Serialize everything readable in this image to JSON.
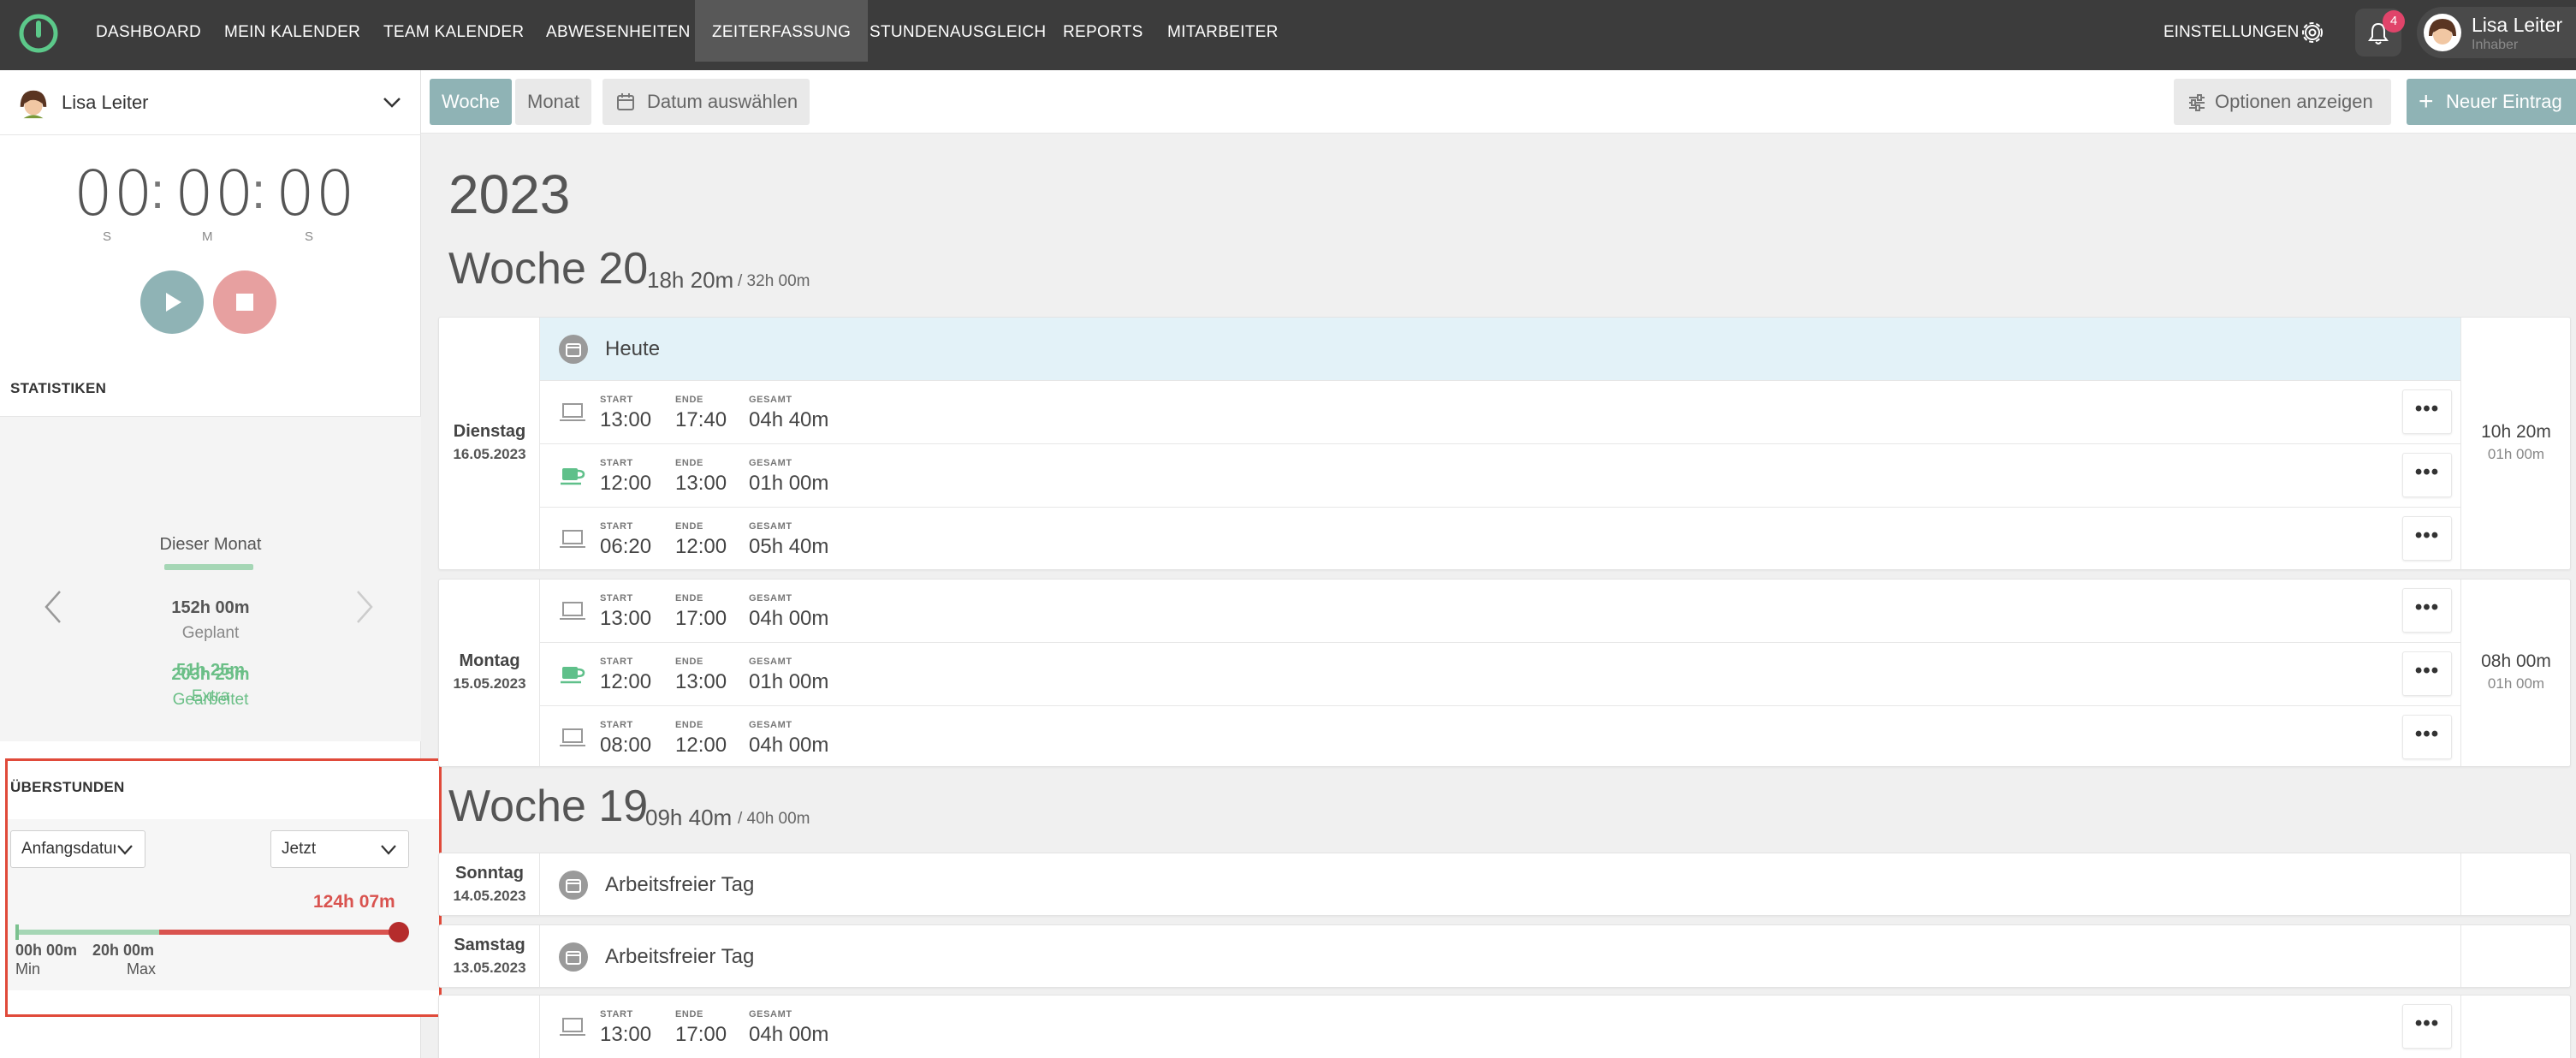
{
  "nav": {
    "items": [
      "DASHBOARD",
      "MEIN KALENDER",
      "TEAM KALENDER",
      "ABWESENHEITEN",
      "ZEITERFASSUNG",
      "STUNDENAUSGLEICH",
      "REPORTS",
      "MITARBEITER"
    ],
    "active": "ZEITERFASSUNG",
    "settings_label": "EINSTELLUNGEN",
    "notification_count": "4",
    "user_name": "Lisa Leiter",
    "user_role": "Inhaber"
  },
  "sidebar": {
    "selected_user": "Lisa Leiter",
    "timer": {
      "h": "00",
      "m": "00",
      "s": "00",
      "unit_h": "S",
      "unit_m": "M",
      "unit_s": "S",
      "sep": ":"
    },
    "stats_title": "STATISTIKEN",
    "stats": {
      "period": "Dieser Monat",
      "planned_value": "152h 00m",
      "planned_label": "Geplant",
      "worked_value": "203h 25m",
      "worked_label": "Gearbeitet",
      "extra_value": "51h 25m",
      "extra_label": "Extra"
    },
    "overtime": {
      "title": "ÜBERSTUNDEN",
      "from_select": "Anfangsdatum",
      "to_select": "Jetzt",
      "value": "124h 07m",
      "min_value": "00h 00m",
      "min_label": "Min",
      "max_value": "20h 00m",
      "max_label": "Max"
    }
  },
  "toolbar": {
    "week": "Woche",
    "month": "Monat",
    "date_picker": "Datum auswählen",
    "options": "Optionen anzeigen",
    "new_entry": "Neuer Eintrag"
  },
  "main": {
    "year": "2023",
    "col_labels": {
      "start": "START",
      "end": "ENDE",
      "total": "GESAMT"
    },
    "more": "•••",
    "week20": {
      "title": "Woche 20",
      "worked": "18h 20m",
      "target": "/ 32h 00m"
    },
    "week19": {
      "title": "Woche 19",
      "worked": "09h 40m",
      "target": "/ 40h 00m"
    },
    "today_label": "Heute",
    "free_day": "Arbeitsfreier Tag",
    "days": [
      {
        "name": "Dienstag",
        "date": "16.05.2023",
        "total": "10h 20m",
        "break": "01h 00m",
        "entries": [
          {
            "type": "work",
            "start": "13:00",
            "end": "17:40",
            "total": "04h 40m"
          },
          {
            "type": "break",
            "start": "12:00",
            "end": "13:00",
            "total": "01h 00m"
          },
          {
            "type": "work",
            "start": "06:20",
            "end": "12:00",
            "total": "05h 40m"
          }
        ]
      },
      {
        "name": "Montag",
        "date": "15.05.2023",
        "total": "08h 00m",
        "break": "01h 00m",
        "entries": [
          {
            "type": "work",
            "start": "13:00",
            "end": "17:00",
            "total": "04h 00m"
          },
          {
            "type": "break",
            "start": "12:00",
            "end": "13:00",
            "total": "01h 00m"
          },
          {
            "type": "work",
            "start": "08:00",
            "end": "12:00",
            "total": "04h 00m"
          }
        ]
      },
      {
        "name": "Sonntag",
        "date": "14.05.2023"
      },
      {
        "name": "Samstag",
        "date": "13.05.2023"
      },
      {
        "entries": [
          {
            "type": "work",
            "start": "13:00",
            "end": "17:00",
            "total": "04h 00m"
          }
        ]
      }
    ]
  },
  "colors": {
    "accent": "#8fb3b5",
    "stop": "#e7a0a0",
    "green": "#6bbf87",
    "red": "#d9534f",
    "nav_bg": "#3c3c3c"
  }
}
